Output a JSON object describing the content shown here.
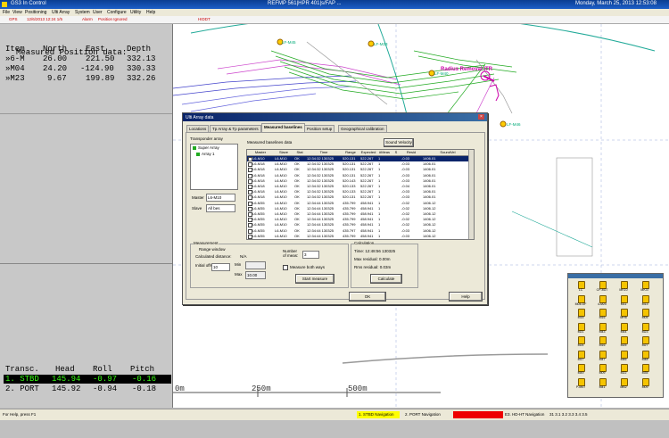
{
  "title_bar": {
    "app_title": "GS3 In Control",
    "center_title": "REFMP 561|HPR 401|s/FAP ...",
    "datetime": "Monday, March 25, 2013 12:53:08"
  },
  "menu": [
    "File",
    "View",
    "Positioning",
    "Ulti Array",
    "System",
    "User",
    "Configure",
    "Utility",
    "Help"
  ],
  "status_row": [
    "GPS",
    "12/6/2013 12:24 1/5",
    "Alarm",
    "Position Ignored",
    "HIDDT"
  ],
  "measured_position": {
    "title": "Measured Position data:",
    "headers": [
      "Item",
      "North",
      "East",
      "Depth"
    ],
    "rows": [
      [
        "»6-M",
        "26.00",
        "221.50",
        "332.13"
      ],
      [
        "»M04",
        "24.20",
        "-124.90",
        "330.33"
      ],
      [
        "»M23",
        "9.67",
        "199.89",
        "332.26"
      ]
    ]
  },
  "transducers": {
    "headers": [
      "Transc.",
      "Head",
      "Roll",
      "Pitch"
    ],
    "rows": [
      [
        "1. STBD",
        "145.94",
        "-0.97",
        "-0.16"
      ],
      [
        "2. PORT",
        "145.92",
        "-0.94",
        "-0.18"
      ]
    ]
  },
  "map": {
    "labels": [
      "LF-M45",
      "LF-M23",
      "Radius Removal ITR",
      "LF-M46",
      "LF-M40"
    ],
    "scale": [
      "0m",
      "250m",
      "500m"
    ]
  },
  "dialog": {
    "title": "Ulti Array data",
    "tabs": [
      "Locations",
      "Tp Array & Tp parameters",
      "Measured baselines",
      "Position setup",
      "Geographical calibration"
    ],
    "transponder_array_label": "Transponder array",
    "array_tree": [
      "Super Array",
      "Array 1"
    ],
    "measured_baselines_label": "Measured baselines data",
    "sound_velocity_btn": "Sound Velocity",
    "table_headers": [
      "Master",
      "Slave",
      "Stat",
      "Time",
      "Range",
      "Expected",
      "#Meas",
      "S",
      "Resid",
      "SoundVel"
    ],
    "table_rows": [
      [
        "L6-M10",
        "L6-M10",
        "OK",
        "12:34:32 130325",
        "520.131",
        "522.267",
        "1",
        "-0.03",
        "1406.01"
      ],
      [
        "L6-M18",
        "L6-M10",
        "OK",
        "12:34:32 130325",
        "520.131",
        "522.267",
        "1",
        "-0.03",
        "1406.01"
      ],
      [
        "L6-M18",
        "L6-M10",
        "OK",
        "12:34:32 130325",
        "520.131",
        "522.267",
        "1",
        "-0.03",
        "1406.01"
      ],
      [
        "L6-M18",
        "L6-M10",
        "OK",
        "12:34:32 130325",
        "520.131",
        "522.267",
        "1",
        "-0.03",
        "1406.01"
      ],
      [
        "L6-M18",
        "L6-M10",
        "OK",
        "12:34:32 130325",
        "520.143",
        "522.267",
        "1",
        "-0.03",
        "1406.01"
      ],
      [
        "L6-M18",
        "L6-M10",
        "OK",
        "12:34:32 130325",
        "520.133",
        "522.267",
        "1",
        "-0.04",
        "1406.01"
      ],
      [
        "L6-M18",
        "L6-M10",
        "OK",
        "12:34:32 130325",
        "520.133",
        "522.267",
        "1",
        "-0.03",
        "1406.01"
      ],
      [
        "L6-M18",
        "L6-M10",
        "OK",
        "12:34:32 130325",
        "520.131",
        "522.267",
        "1",
        "-0.03",
        "1406.01"
      ],
      [
        "L6-M35",
        "L6-M10",
        "OK",
        "12:34:44 130325",
        "435.799",
        "458.941",
        "1",
        "-0.02",
        "1406.12"
      ],
      [
        "L6-M35",
        "L6-M10",
        "OK",
        "12:34:44 130325",
        "435.799",
        "458.941",
        "1",
        "-0.02",
        "1406.12"
      ],
      [
        "L6-M35",
        "L6-M10",
        "OK",
        "12:34:44 130325",
        "435.799",
        "458.941",
        "1",
        "-0.02",
        "1406.12"
      ],
      [
        "L6-M35",
        "L6-M10",
        "OK",
        "12:34:44 130325",
        "435.799",
        "458.941",
        "1",
        "-0.02",
        "1406.12"
      ],
      [
        "L6-M35",
        "L6-M10",
        "OK",
        "12:34:44 130325",
        "435.799",
        "458.941",
        "1",
        "-0.02",
        "1406.12"
      ],
      [
        "L6-M35",
        "L6-M10",
        "OK",
        "12:34:44 130325",
        "435.797",
        "458.941",
        "1",
        "-0.03",
        "1406.12"
      ],
      [
        "L6-M35",
        "L6-M10",
        "OK",
        "12:34:44 130325",
        "435.799",
        "458.941",
        "1",
        "-0.03",
        "1406.12"
      ]
    ],
    "master_label": "Master",
    "master_value": "L6-M10",
    "slave_label": "Slave",
    "slave_value": "All bes",
    "measurement": {
      "group": "Measurement",
      "range_window": "Range window",
      "calc_distance": "Calculated distance:",
      "na": "N/A",
      "initial_offset": "Initial offset",
      "offset_value": "10",
      "min_label": "Min",
      "min_value": "",
      "max_label": "Max",
      "max_value": "10.00",
      "num_meas_label": "Number of meas:",
      "num_meas_value": "3",
      "both_ways": "Measure both ways",
      "start_btn": "Start measure"
    },
    "calculation": {
      "group": "Calculation",
      "time": "Time: 12:48:56 130325",
      "max_residual": "Max residual: 0.00m",
      "rms_residual": "Rms residual: 0.03m",
      "calc_btn": "Calculate"
    },
    "ok_btn": "OK",
    "help_btn": "Help"
  },
  "palette": {
    "items": [
      "LC",
      "CP-M27",
      "MK10",
      "MK37",
      "M04-OF",
      "4-M20",
      "M11",
      "M13",
      "M15",
      "M16",
      "MH5",
      "M05",
      "M21",
      "M43",
      "M44",
      "M23",
      "M24",
      "M16",
      "M25",
      "M27",
      "M17",
      "M47",
      "M46",
      "M48",
      "M49",
      "M09",
      "M22",
      "M35",
      "P-M47",
      "M41",
      "MB2",
      "M09"
    ]
  },
  "bottom": {
    "help_text": "For Help, press F1",
    "nav1": "1. STBD Navigation",
    "nav2": "2. PORT Navigation",
    "nav3": "E3. HD-HT Navigation",
    "nums": "31 3.1 3.2 3.3 3.4 3.5"
  }
}
